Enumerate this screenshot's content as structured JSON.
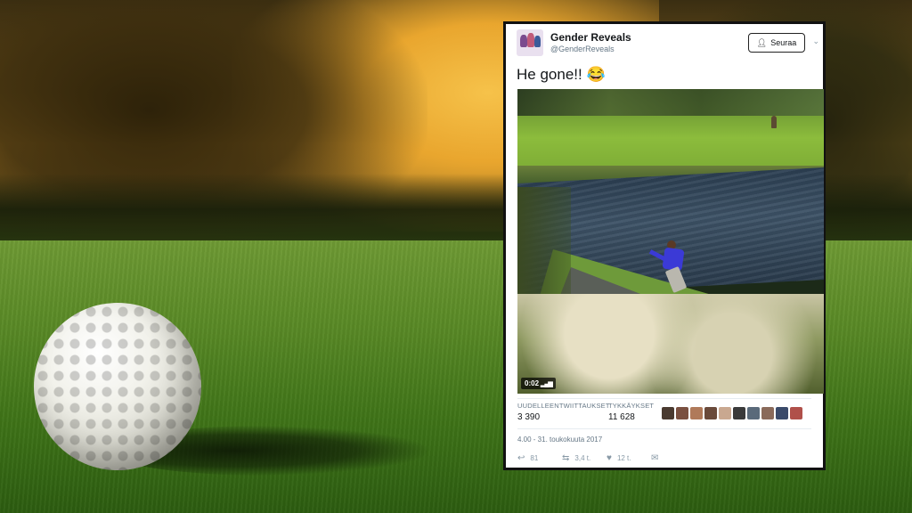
{
  "tweet": {
    "display_name": "Gender Reveals",
    "handle": "@GenderReveals",
    "follow_label": "Seuraa",
    "text": "He gone!!",
    "emoji": "😂",
    "video_time": "0:02",
    "retweets_label": "UUDELLEENTWIITTAUKSET",
    "retweets_count": "3 390",
    "likes_label": "TYKKÄYKSET",
    "likes_count": "11 628",
    "timestamp": "4.00 - 31. toukokuuta 2017",
    "reply_count": "81",
    "retweet_count_short": "3,4 t.",
    "like_count_short": "12 t."
  },
  "icons": {
    "follow_icon": "person-plus-icon",
    "dropdown_icon": "chevron-down-icon",
    "reply_icon": "reply-icon",
    "retweet_icon": "retweet-icon",
    "like_icon": "heart-icon",
    "dm_icon": "envelope-icon"
  },
  "liker_colors": [
    "#4a3a30",
    "#7a5040",
    "#b07a5a",
    "#6a4a3a",
    "#c9a890",
    "#3a3a3a",
    "#5a6a7a",
    "#8a6a5a",
    "#3a4a6a",
    "#b0504a"
  ]
}
